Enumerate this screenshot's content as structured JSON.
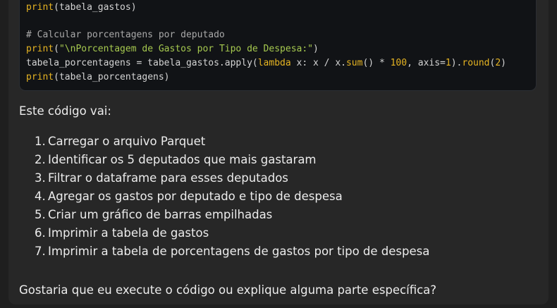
{
  "code": {
    "line1": {
      "fn": "print",
      "rest": "(tabela_gastos)"
    },
    "line2": {
      "comment": "# Calcular porcentagens por deputado"
    },
    "line3": {
      "fn": "print",
      "open": "(",
      "str": "\"\\nPorcentagem de Gastos por Tipo de Despesa:\"",
      "close": ")"
    },
    "line4": {
      "a": "tabela_porcentagens = tabela_gastos.apply(",
      "kw": "lambda",
      "b": " x: x / x.",
      "sum": "sum",
      "c": "() * ",
      "n100": "100",
      "d": ", axis=",
      "n1": "1",
      "e": ").",
      "round": "round",
      "f": "(",
      "n2": "2",
      "g": ")"
    },
    "line5": {
      "fn": "print",
      "rest": "(tabela_porcentagens)"
    }
  },
  "response": {
    "intro": "Este código vai:",
    "steps": [
      {
        "num": "1.",
        "text": "Carregar o arquivo Parquet"
      },
      {
        "num": "2.",
        "text": "Identificar os 5 deputados que mais gastaram"
      },
      {
        "num": "3.",
        "text": "Filtrar o dataframe para esses deputados"
      },
      {
        "num": "4.",
        "text": "Agregar os gastos por deputado e tipo de despesa"
      },
      {
        "num": "5.",
        "text": "Criar um gráfico de barras empilhadas"
      },
      {
        "num": "6.",
        "text": "Imprimir a tabela de gastos"
      },
      {
        "num": "7.",
        "text": "Imprimir a tabela de porcentagens de gastos por tipo de despesa"
      }
    ],
    "closing": "Gostaria que eu execute o código ou explique alguma parte específica?"
  }
}
